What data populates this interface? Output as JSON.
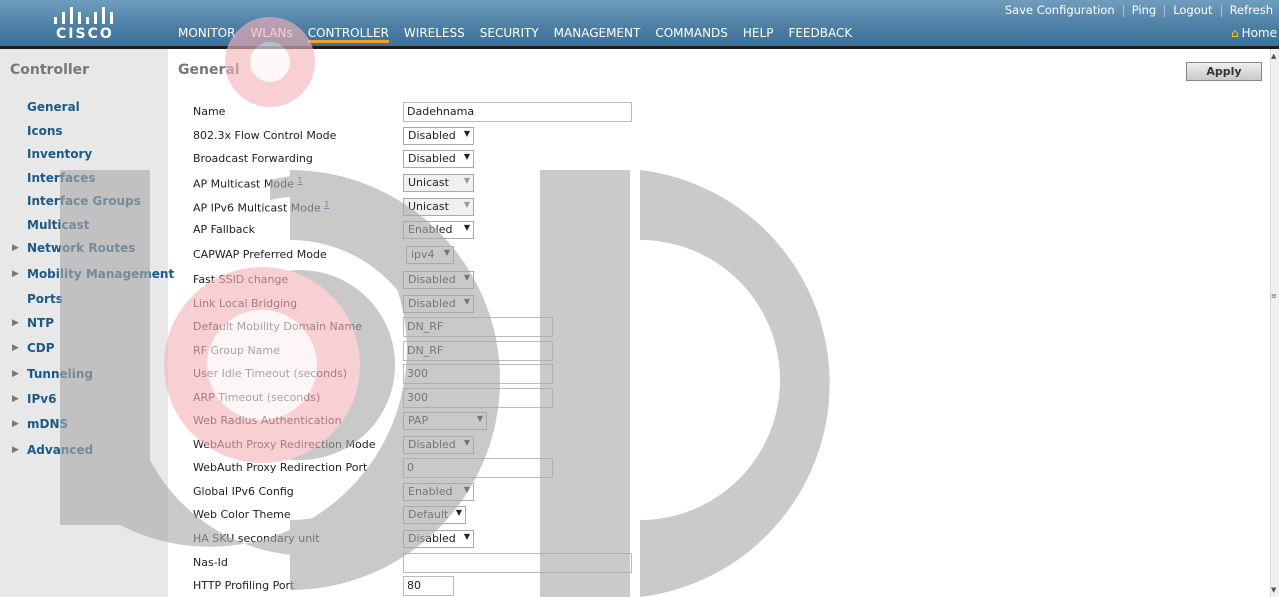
{
  "header": {
    "logo_text": "CISCO",
    "utility_links": [
      "Save Configuration",
      "Ping",
      "Logout",
      "Refresh"
    ],
    "nav_items": [
      "MONITOR",
      "WLANs",
      "CONTROLLER",
      "WIRELESS",
      "SECURITY",
      "MANAGEMENT",
      "COMMANDS",
      "HELP",
      "FEEDBACK"
    ],
    "active_nav": "CONTROLLER",
    "home_label": "Home"
  },
  "sidebar": {
    "title": "Controller",
    "items": [
      {
        "label": "General",
        "expandable": false
      },
      {
        "label": "Icons",
        "expandable": false
      },
      {
        "label": "Inventory",
        "expandable": false
      },
      {
        "label": "Interfaces",
        "expandable": false
      },
      {
        "label": "Interface Groups",
        "expandable": false
      },
      {
        "label": "Multicast",
        "expandable": false
      },
      {
        "label": "Network Routes",
        "expandable": true
      },
      {
        "label": "Mobility Management",
        "expandable": true
      },
      {
        "label": "Ports",
        "expandable": false
      },
      {
        "label": "NTP",
        "expandable": true
      },
      {
        "label": "CDP",
        "expandable": true
      },
      {
        "label": "Tunneling",
        "expandable": true
      },
      {
        "label": "IPv6",
        "expandable": true
      },
      {
        "label": "mDNS",
        "expandable": true
      },
      {
        "label": "Advanced",
        "expandable": true
      }
    ]
  },
  "main": {
    "title": "General",
    "apply_label": "Apply",
    "footnote_marker": "1",
    "rows": [
      {
        "label": "Name",
        "type": "text",
        "value": "Dadehnama"
      },
      {
        "label": "802.3x Flow Control Mode",
        "type": "select",
        "value": "Disabled"
      },
      {
        "label": "Broadcast Forwarding",
        "type": "select",
        "value": "Disabled"
      },
      {
        "label": "AP Multicast Mode",
        "type": "select",
        "value": "Unicast",
        "footnote": true,
        "disabled": true
      },
      {
        "label": "AP IPv6 Multicast Mode",
        "type": "select",
        "value": "Unicast",
        "footnote": true,
        "disabled": true
      },
      {
        "label": "AP Fallback",
        "type": "select",
        "value": "Enabled"
      },
      {
        "label": "CAPWAP Preferred Mode",
        "type": "select",
        "value": "ipv4"
      },
      {
        "label": "Fast SSID change",
        "type": "select",
        "value": "Disabled"
      },
      {
        "label": "Link Local Bridging",
        "type": "select",
        "value": "Disabled"
      },
      {
        "label": "Default Mobility Domain Name",
        "type": "text",
        "value": "DN_RF"
      },
      {
        "label": "RF Group Name",
        "type": "text",
        "value": "DN_RF"
      },
      {
        "label": "User Idle Timeout (seconds)",
        "type": "text",
        "value": "300"
      },
      {
        "label": "ARP Timeout (seconds)",
        "type": "text",
        "value": "300"
      },
      {
        "label": "Web Radius Authentication",
        "type": "select",
        "value": "PAP"
      },
      {
        "label": "WebAuth Proxy Redirection Mode",
        "type": "select",
        "value": "Disabled"
      },
      {
        "label": "WebAuth Proxy Redirection Port",
        "type": "text",
        "value": "0"
      },
      {
        "label": "Global IPv6 Config",
        "type": "select",
        "value": "Enabled"
      },
      {
        "label": "Web Color Theme",
        "type": "select",
        "value": "Default"
      },
      {
        "label": "HA SKU secondary unit",
        "type": "select",
        "value": "Disabled"
      },
      {
        "label": "Nas-Id",
        "type": "text",
        "value": ""
      },
      {
        "label": "HTTP Profiling Port",
        "type": "text",
        "value": "80"
      }
    ]
  },
  "colors": {
    "header_blue": "#4b7ea3",
    "nav_active_underline": "#f0a030",
    "sidebar_bg": "#e8e8e8",
    "sidebar_link": "#1b5a86",
    "watermark_gray": "#a9a9a9",
    "watermark_red": "#f5b3b8"
  }
}
